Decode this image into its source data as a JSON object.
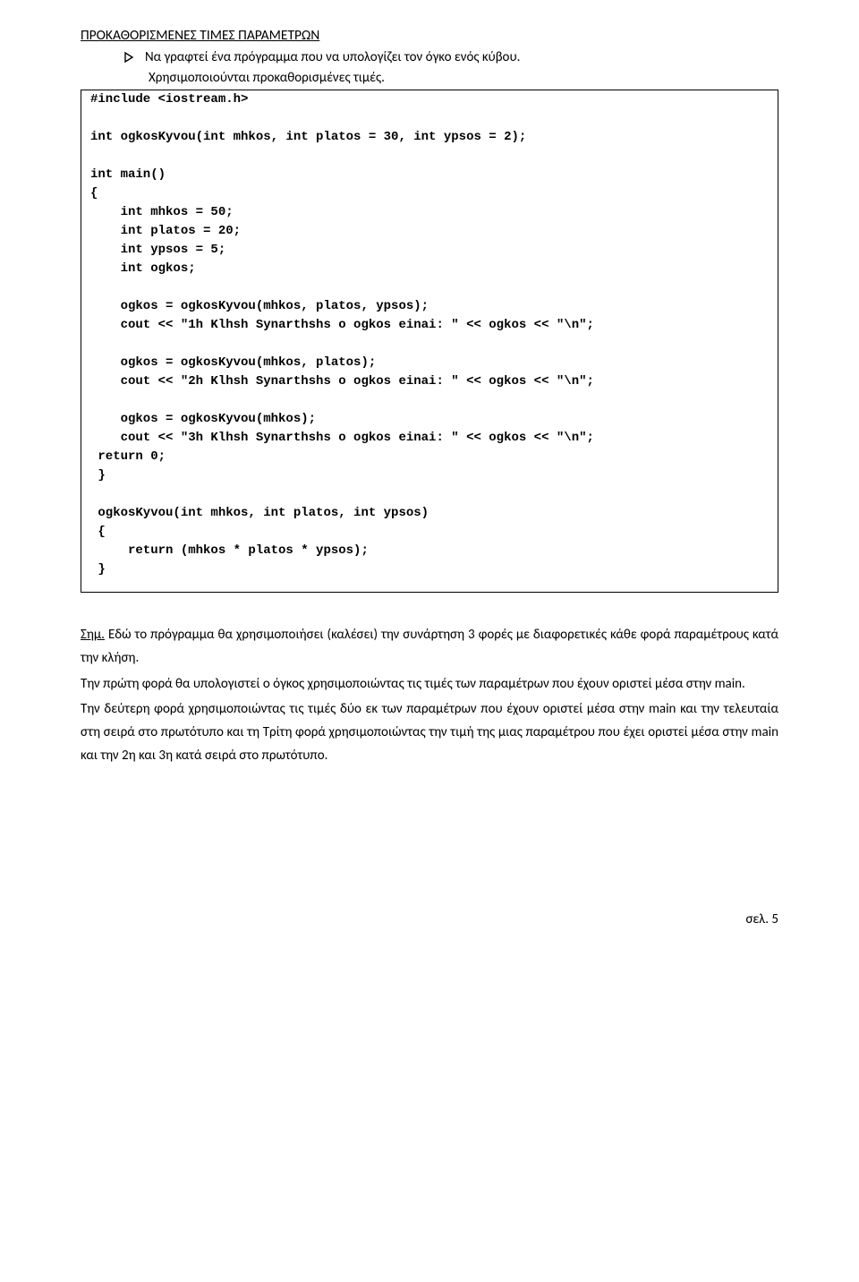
{
  "heading": "ΠΡΟΚΑΘΟΡΙΣΜΕΝΕΣ ΤΙΜΕΣ ΠΑΡΑΜΕΤΡΩΝ",
  "bullet": {
    "line1": "Να γραφτεί ένα πρόγραμμα που να υπολογίζει τον όγκο ενός κύβου.",
    "line2": "Χρησιμοποιούνται προκαθορισμένες τιμές."
  },
  "code": {
    "l01": "#include <iostream.h>",
    "l02": "",
    "l03": "int ogkosKyvou(int mhkos, int platos = 30, int ypsos = 2);",
    "l04": "",
    "l05": "int main()",
    "l06": "{",
    "l07": "    int mhkos = 50;",
    "l08": "    int platos = 20;",
    "l09": "    int ypsos = 5;",
    "l10": "    int ogkos;",
    "l11": "",
    "l12": "    ogkos = ogkosKyvou(mhkos, platos, ypsos);",
    "l13": "    cout << \"1h Klhsh Synarthshs o ogkos einai: \" << ogkos << \"\\n\";",
    "l14": "",
    "l15": "    ogkos = ogkosKyvou(mhkos, platos);",
    "l16": "    cout << \"2h Klhsh Synarthshs o ogkos einai: \" << ogkos << \"\\n\";",
    "l17": "",
    "l18": "    ogkos = ogkosKyvou(mhkos);",
    "l19": "    cout << \"3h Klhsh Synarthshs o ogkos einai: \" << ogkos << \"\\n\";",
    "l20": " return 0;",
    "l21": " }",
    "l22": "",
    "l23": " ogkosKyvou(int mhkos, int platos, int ypsos)",
    "l24": " {",
    "l25": "     return (mhkos * platos * ypsos);",
    "l26": " }"
  },
  "note": {
    "p1a": "Σημ.",
    "p1b": " Εδώ το πρόγραμμα θα χρησιμοποιήσει (καλέσει) την συνάρτηση 3 φορές με διαφορετικές κάθε φορά παραμέτρους κατά την κλήση.",
    "p2": "Την πρώτη φορά θα υπολογιστεί ο όγκος χρησιμοποιώντας τις τιμές των παραμέτρων που έχουν οριστεί μέσα στην main.",
    "p3": "Την δεύτερη φορά  χρησιμοποιώντας τις τιμές δύο εκ των παραμέτρων που έχουν οριστεί μέσα στην main και την τελευταία στη σειρά στο πρωτότυπο και τη Τρίτη φορά χρησιμοποιώντας την τιμή της μιας παραμέτρου που έχει οριστεί μέσα στην main και την 2η και 3η κατά σειρά στο πρωτότυπο."
  },
  "footer": "σελ. 5"
}
